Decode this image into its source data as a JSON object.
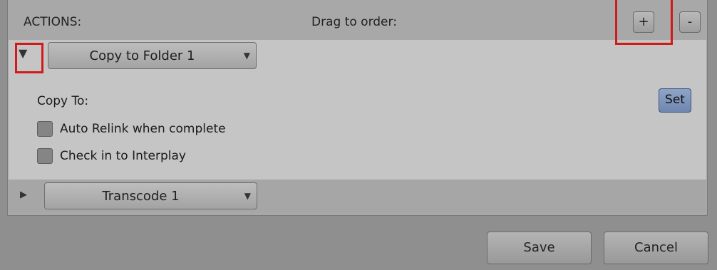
{
  "header": {
    "actions_label": "ACTIONS:",
    "drag_label": "Drag to order:",
    "add_label": "+",
    "remove_label": "-"
  },
  "actions": [
    {
      "name": "Copy to Folder 1",
      "expanded": true,
      "expand_icon": "triangle-down-icon",
      "copy_to_label": "Copy To:",
      "set_label": "Set",
      "options": [
        {
          "label": "Auto Relink when complete",
          "checked": false
        },
        {
          "label": "Check in to Interplay",
          "checked": false
        }
      ]
    },
    {
      "name": "Transcode 1",
      "expanded": false,
      "expand_icon": "triangle-right-icon"
    }
  ],
  "footer": {
    "save_label": "Save",
    "cancel_label": "Cancel"
  },
  "colors": {
    "highlight": "#d11a1a",
    "set_button": "#7b91b9"
  }
}
